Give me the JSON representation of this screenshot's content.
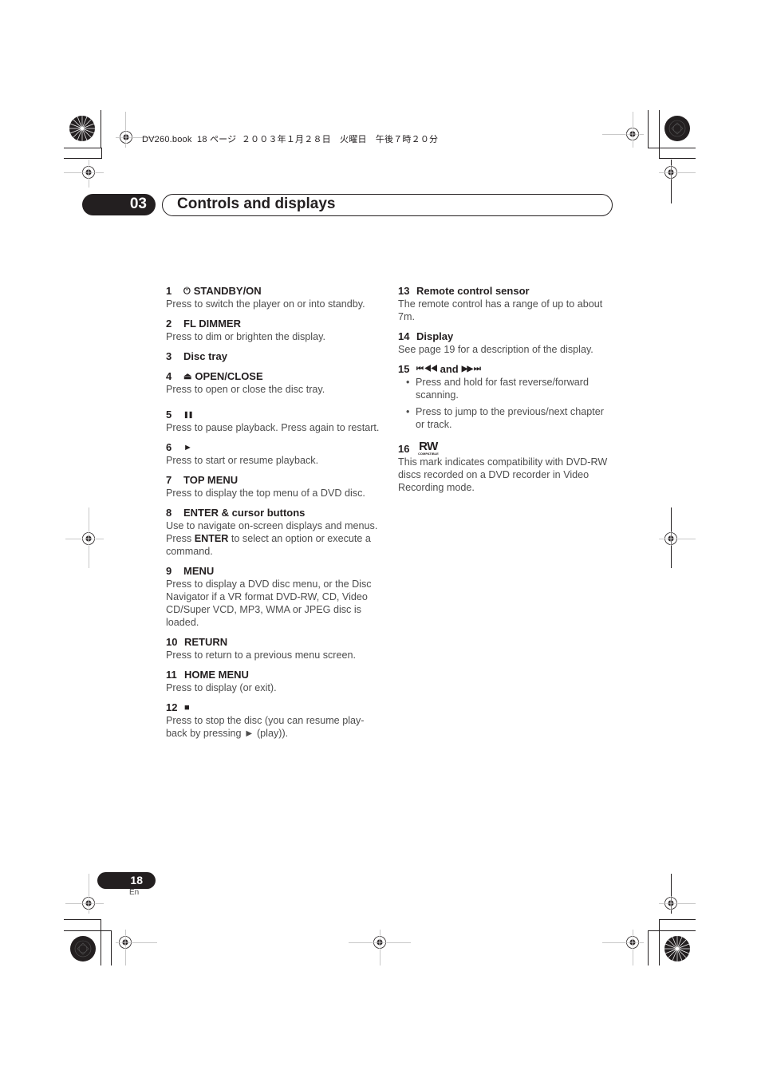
{
  "print_header": "DV260.book  18 ページ  ２００３年１月２８日　火曜日　午後７時２０分",
  "chapter": {
    "number": "03",
    "title": "Controls and displays"
  },
  "left_column": [
    {
      "num": "1",
      "icon": "power-icon",
      "symbol": "⏻",
      "title": "STANDBY/ON",
      "desc": "Press to switch the player on or into standby."
    },
    {
      "num": "2",
      "title": "FL DIMMER",
      "desc": "Press to dim or brighten the display."
    },
    {
      "num": "3",
      "title": "Disc tray",
      "desc": ""
    },
    {
      "num": "4",
      "icon": "eject-icon",
      "symbol": "⏏",
      "title": "OPEN/CLOSE",
      "desc": "Press to open or close the disc tray."
    },
    {
      "num": "5",
      "icon": "pause-icon",
      "symbol": "❚❚",
      "title": "",
      "desc": "Press to pause playback. Press again to restart."
    },
    {
      "num": "6",
      "icon": "play-icon",
      "symbol": "►",
      "title": "",
      "desc": "Press to start or resume playback."
    },
    {
      "num": "7",
      "title": "TOP MENU",
      "desc": "Press to display the top menu of a DVD disc."
    },
    {
      "num": "8",
      "title": "ENTER & cursor buttons",
      "desc_pre": "Use to navigate on-screen displays and menus. Press ",
      "desc_bold": "ENTER",
      "desc_post": " to select an option or execute a command."
    },
    {
      "num": "9",
      "title": "MENU",
      "desc": "Press to display a DVD disc menu, or the Disc Navigator if a VR format DVD-RW, CD, Video CD/Super VCD, MP3, WMA or JPEG disc is loaded."
    },
    {
      "num": "10",
      "title": "RETURN",
      "desc": "Press to return to a previous menu screen."
    },
    {
      "num": "11",
      "title": "HOME MENU",
      "desc": "Press to display (or exit)."
    },
    {
      "num": "12",
      "icon": "stop-icon",
      "symbol": "■",
      "title": "",
      "desc": "Press to stop the disc (you can resume play-back by pressing ► (play))."
    }
  ],
  "right_column": [
    {
      "num": "13",
      "title": "Remote control sensor",
      "desc": "The remote control has a range of up to about 7m."
    },
    {
      "num": "14",
      "title": "Display",
      "desc": "See page 19 for a description of the display."
    },
    {
      "num": "15",
      "title_symbols_left": "⏮ ◀◀",
      "title_and": "and",
      "title_symbols_right": "▶▶ ⏭",
      "bullets": [
        "Press and hold for fast reverse/forward scanning.",
        "Press to jump to the previous/next chapter or track."
      ]
    },
    {
      "num": "16",
      "mark_main": "RW",
      "mark_sub": "COMPATIBLE",
      "desc": "This mark indicates compatibility with DVD-RW discs recorded on a DVD recorder in Video Recording mode."
    }
  ],
  "footer": {
    "page_number": "18",
    "language": "En"
  }
}
